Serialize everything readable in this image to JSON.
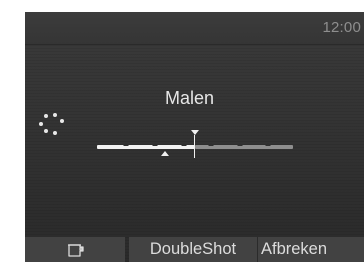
{
  "status_bar": {
    "time": "12:00"
  },
  "main": {
    "title": "Malen"
  },
  "icons": {
    "spinner": "loading-spinner-icon",
    "cup": "cup-icon"
  },
  "grind_slider": {
    "value_fraction": 0.5,
    "steps": 6
  },
  "softkeys": {
    "left_icon": "cup-icon",
    "double_shot_label": "DoubleShot",
    "cancel_label": "Afbreken"
  },
  "colors": {
    "background": "#333333",
    "text": "#e6e6e6",
    "track_filled": "#f2f2f2",
    "track_empty": "#8e8e8e",
    "softkey_bg": "#424242"
  }
}
